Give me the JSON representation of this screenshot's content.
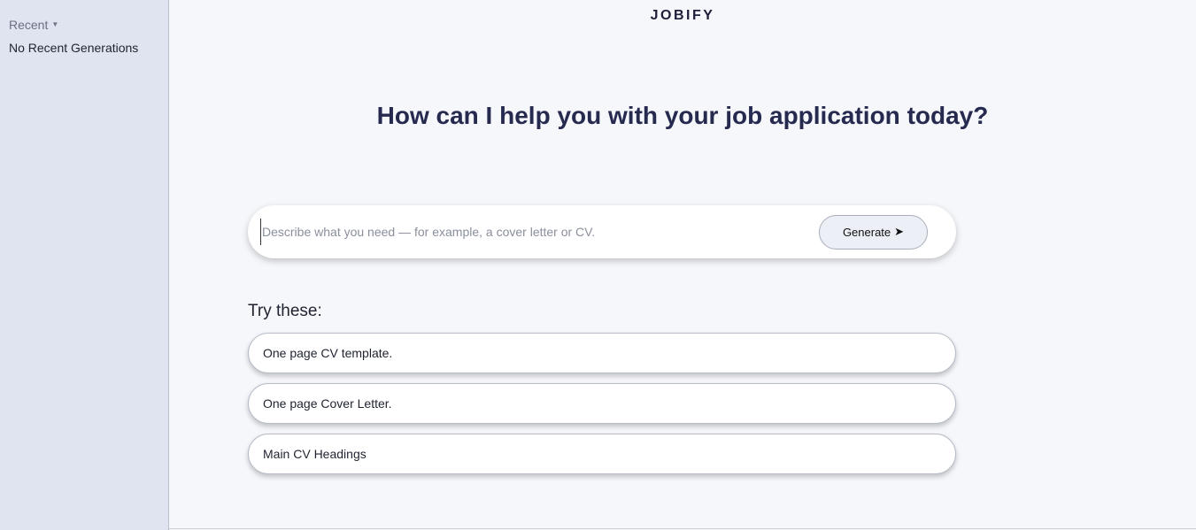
{
  "sidebar": {
    "recent_label": "Recent",
    "recent_caret_icon": "caret-down-icon",
    "empty_text": "No Recent Generations"
  },
  "header": {
    "brand": "JOBIFY"
  },
  "main": {
    "headline": "How can I help you with your job application today?",
    "composer": {
      "placeholder": "Describe what you need — for example, a cover letter or CV.",
      "value": "",
      "generate_label": "Generate",
      "generate_icon": "send-arrow-icon"
    },
    "try_title": "Try these:",
    "suggestions": [
      {
        "label": "One page CV template."
      },
      {
        "label": "One page Cover Letter."
      },
      {
        "label": "Main CV Headings"
      }
    ]
  },
  "colors": {
    "sidebar_bg": "#dfe4f0",
    "main_bg": "#f6f7fb",
    "headline": "#262a4f",
    "brand": "#1d1f3a"
  }
}
